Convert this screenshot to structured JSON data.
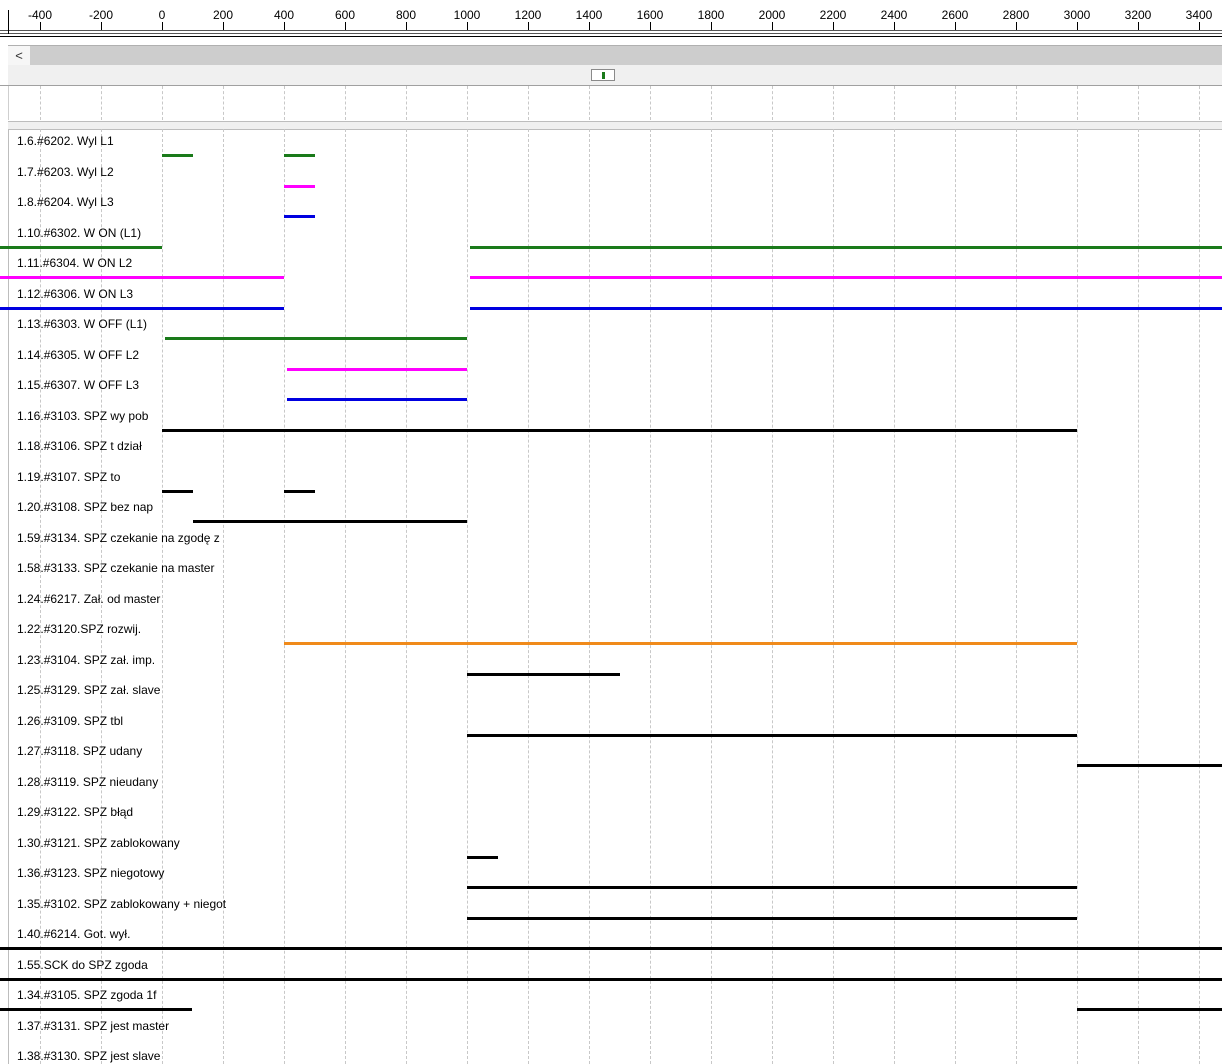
{
  "ruler": {
    "ticks": [
      "-400",
      "-200",
      "0",
      "200",
      "400",
      "600",
      "800",
      "1000",
      "1200",
      "1400",
      "1600",
      "1800",
      "2000",
      "2200",
      "2400",
      "2600",
      "2800",
      "3000",
      "3200",
      "3400"
    ]
  },
  "scrollbar": {
    "left_arrow": "<"
  },
  "colors": {
    "green": "#1a7a1a",
    "magenta": "#ff00ff",
    "blue": "#0000e0",
    "black": "#000000",
    "orange": "#f08a1a"
  },
  "tracks": [
    {
      "label": "1.6.#6202. Wyl L1",
      "color": "green",
      "segments": [
        [
          0,
          100
        ],
        [
          400,
          500
        ]
      ]
    },
    {
      "label": "1.7.#6203. Wyl L2",
      "color": "magenta",
      "segments": [
        [
          400,
          500
        ]
      ]
    },
    {
      "label": "1.8.#6204. Wyl L3",
      "color": "blue",
      "segments": [
        [
          400,
          500
        ]
      ]
    },
    {
      "label": "1.10.#6302. W ON (L1)",
      "color": "green",
      "segments": [
        [
          -530,
          0
        ],
        [
          1010,
          3560
        ]
      ]
    },
    {
      "label": "1.11.#6304. W ON L2",
      "color": "magenta",
      "segments": [
        [
          -530,
          400
        ],
        [
          1010,
          3560
        ]
      ]
    },
    {
      "label": "1.12.#6306.  W ON L3",
      "color": "blue",
      "segments": [
        [
          -530,
          400
        ],
        [
          1010,
          3560
        ]
      ]
    },
    {
      "label": "1.13.#6303. W OFF (L1)",
      "color": "green",
      "segments": [
        [
          10,
          1000
        ]
      ]
    },
    {
      "label": "1.14.#6305. W OFF L2",
      "color": "magenta",
      "segments": [
        [
          410,
          1000
        ]
      ]
    },
    {
      "label": "1.15.#6307. W OFF L3",
      "color": "blue",
      "segments": [
        [
          410,
          1000
        ]
      ]
    },
    {
      "label": "1.16.#3103. SPZ wy pob",
      "color": "black",
      "segments": [
        [
          0,
          3000
        ]
      ]
    },
    {
      "label": "1.18.#3106. SPZ t dział",
      "color": "black",
      "segments": []
    },
    {
      "label": "1.19.#3107. SPZ to",
      "color": "black",
      "segments": [
        [
          0,
          100
        ],
        [
          400,
          500
        ]
      ]
    },
    {
      "label": "1.20.#3108. SPZ bez nap",
      "color": "black",
      "segments": [
        [
          100,
          1000
        ]
      ]
    },
    {
      "label": "1.59.#3134. SPZ czekanie na zgodę z",
      "color": "black",
      "segments": []
    },
    {
      "label": "1.58.#3133. SPZ czekanie na master",
      "color": "black",
      "segments": []
    },
    {
      "label": "1.24.#6217. Zał. od master",
      "color": "black",
      "segments": []
    },
    {
      "label": "1.22.#3120.SPZ rozwij.",
      "color": "orange",
      "segments": [
        [
          400,
          3000
        ]
      ]
    },
    {
      "label": "1.23.#3104. SPZ zał. imp.",
      "color": "black",
      "segments": [
        [
          1000,
          1500
        ]
      ]
    },
    {
      "label": "1.25.#3129. SPZ zał. slave",
      "color": "black",
      "segments": []
    },
    {
      "label": "1.26.#3109. SPZ tbl",
      "color": "black",
      "segments": [
        [
          1000,
          3000
        ]
      ]
    },
    {
      "label": "1.27.#3118. SPZ udany",
      "color": "black",
      "segments": [
        [
          3000,
          3560
        ]
      ]
    },
    {
      "label": "1.28.#3119. SPZ nieudany",
      "color": "black",
      "segments": []
    },
    {
      "label": "1.29.#3122. SPZ błąd",
      "color": "black",
      "segments": []
    },
    {
      "label": "1.30.#3121. SPZ zablokowany",
      "color": "black",
      "segments": [
        [
          1000,
          1100
        ]
      ]
    },
    {
      "label": "1.36.#3123. SPZ niegotowy",
      "color": "black",
      "segments": [
        [
          1000,
          3000
        ]
      ]
    },
    {
      "label": "1.35.#3102. SPZ zablokowany + niegot",
      "color": "black",
      "segments": [
        [
          1000,
          3000
        ]
      ]
    },
    {
      "label": "1.40.#6214. Got. wył.",
      "color": "black",
      "segments": [
        [
          -530,
          3560
        ]
      ]
    },
    {
      "label": "1.55.SCK do SPZ zgoda",
      "color": "black",
      "segments": [
        [
          -530,
          3560
        ]
      ]
    },
    {
      "label": "1.34.#3105. SPZ zgoda 1f",
      "color": "black",
      "segments": [
        [
          -530,
          100
        ],
        [
          3000,
          3560
        ]
      ]
    },
    {
      "label": "1.37.#3131. SPZ jest master",
      "color": "black",
      "segments": []
    },
    {
      "label": "1.38.#3130. SPZ jest slave",
      "color": "black",
      "segments": []
    }
  ]
}
